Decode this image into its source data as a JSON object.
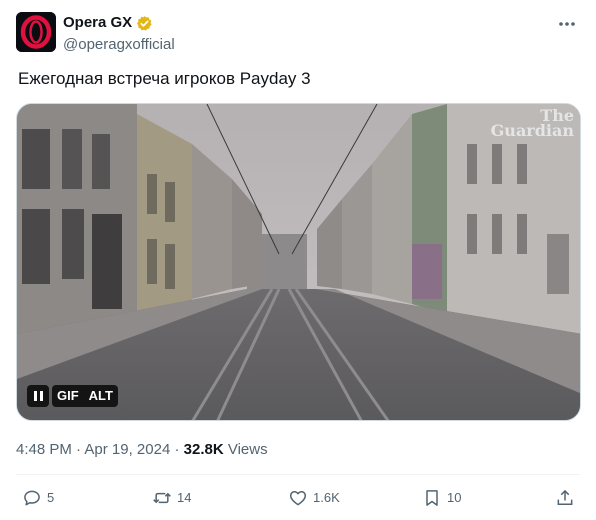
{
  "account": {
    "display_name": "Opera GX",
    "handle": "@operagxofficial",
    "verified": true,
    "avatar_icon": "opera-gx-logo-icon",
    "brand_color": "#e0103f"
  },
  "post": {
    "text": "Ежегодная встреча игроков Payday 3"
  },
  "media": {
    "type": "gif",
    "watermark_line1": "The",
    "watermark_line2": "Guardian",
    "pause_icon": "pause-icon",
    "gif_label": "GIF",
    "alt_label": "ALT"
  },
  "meta": {
    "time": "4:48 PM",
    "separator": "·",
    "date": "Apr 19, 2024",
    "views_count": "32.8K",
    "views_label": "Views"
  },
  "actions": {
    "replies": "5",
    "reposts": "14",
    "likes": "1.6K",
    "bookmarks": "10"
  },
  "colors": {
    "text_primary": "#0f1419",
    "text_secondary": "#536471",
    "verified_badge": "#e2b719"
  }
}
